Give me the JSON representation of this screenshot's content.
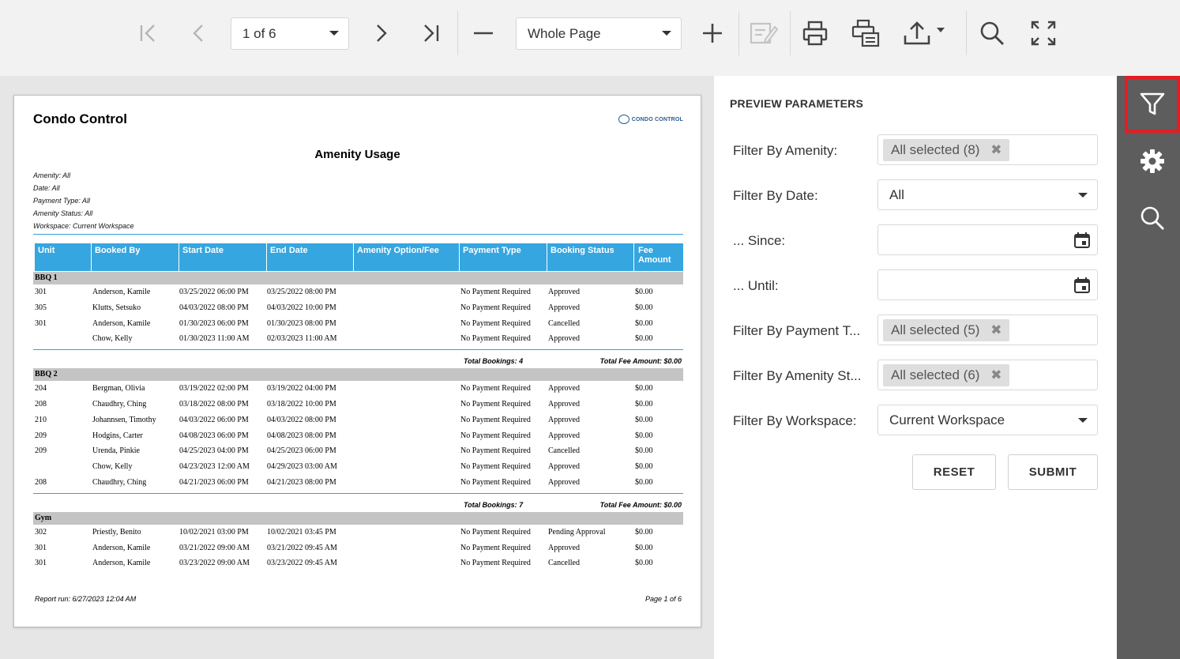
{
  "toolbar": {
    "page_selector": "1 of 6",
    "zoom_selector": "Whole Page",
    "icons": [
      "first-page-icon",
      "prev-page-icon",
      "next-page-icon",
      "last-page-icon",
      "zoom-out-icon",
      "zoom-in-icon",
      "edit-icon",
      "print-icon",
      "print-page-icon",
      "export-icon",
      "search-icon",
      "fullscreen-icon"
    ]
  },
  "report": {
    "company": "Condo Control",
    "logo_text": "CONDO CONTROL",
    "title": "Amenity Usage",
    "filters": [
      "Amenity: All",
      "Date: All",
      "Payment Type: All",
      "Amenity Status: All",
      "Workspace: Current Workspace"
    ],
    "columns": [
      "Unit",
      "Booked By",
      "Start Date",
      "End Date",
      "Amenity Option/Fee",
      "Payment Type",
      "Booking Status",
      "Fee Amount"
    ],
    "groups": [
      {
        "name": "BBQ 1",
        "rows": [
          [
            "301",
            "Anderson, Kamile",
            "03/25/2022 06:00 PM",
            "03/25/2022 08:00 PM",
            "",
            "No Payment Required",
            "Approved",
            "$0.00"
          ],
          [
            "305",
            "Klutts, Setsuko",
            "04/03/2022 08:00 PM",
            "04/03/2022 10:00 PM",
            "",
            "No Payment Required",
            "Approved",
            "$0.00"
          ],
          [
            "301",
            "Anderson, Kamile",
            "01/30/2023 06:00 PM",
            "01/30/2023 08:00 PM",
            "",
            "No Payment Required",
            "Cancelled",
            "$0.00"
          ],
          [
            "",
            "Chow, Kelly",
            "01/30/2023 11:00 AM",
            "02/03/2023 11:00 AM",
            "",
            "No Payment Required",
            "Approved",
            "$0.00"
          ]
        ],
        "total_bookings": "Total Bookings: 4",
        "total_fee": "Total Fee Amount: $0.00"
      },
      {
        "name": "BBQ 2",
        "rows": [
          [
            "204",
            "Bergman, Olivia",
            "03/19/2022 02:00 PM",
            "03/19/2022 04:00 PM",
            "",
            "No Payment Required",
            "Approved",
            "$0.00"
          ],
          [
            "208",
            "Chaudhry, Ching",
            "03/18/2022 08:00 PM",
            "03/18/2022 10:00 PM",
            "",
            "No Payment Required",
            "Approved",
            "$0.00"
          ],
          [
            "210",
            "Johannsen, Timothy",
            "04/03/2022 06:00 PM",
            "04/03/2022 08:00 PM",
            "",
            "No Payment Required",
            "Approved",
            "$0.00"
          ],
          [
            "209",
            "Hodgins, Carter",
            "04/08/2023 06:00 PM",
            "04/08/2023 08:00 PM",
            "",
            "No Payment Required",
            "Approved",
            "$0.00"
          ],
          [
            "209",
            "Urenda, Pinkie",
            "04/25/2023 04:00 PM",
            "04/25/2023 06:00 PM",
            "",
            "No Payment Required",
            "Cancelled",
            "$0.00"
          ],
          [
            "",
            "Chow, Kelly",
            "04/23/2023 12:00 AM",
            "04/29/2023 03:00 AM",
            "",
            "No Payment Required",
            "Approved",
            "$0.00"
          ],
          [
            "208",
            "Chaudhry, Ching",
            "04/21/2023 06:00 PM",
            "04/21/2023 08:00 PM",
            "",
            "No Payment Required",
            "Approved",
            "$0.00"
          ]
        ],
        "total_bookings": "Total Bookings: 7",
        "total_fee": "Total Fee Amount: $0.00"
      },
      {
        "name": "Gym",
        "rows": [
          [
            "302",
            "Priestly, Benito",
            "10/02/2021 03:00 PM",
            "10/02/2021 03:45 PM",
            "",
            "No Payment Required",
            "Pending Approval",
            "$0.00"
          ],
          [
            "301",
            "Anderson, Kamile",
            "03/21/2022 09:00 AM",
            "03/21/2022 09:45 AM",
            "",
            "No Payment Required",
            "Approved",
            "$0.00"
          ],
          [
            "301",
            "Anderson, Kamile",
            "03/23/2022 09:00 AM",
            "03/23/2022 09:45 AM",
            "",
            "No Payment Required",
            "Cancelled",
            "$0.00"
          ]
        ]
      }
    ],
    "footer_left": "Report run: 6/27/2023 12:04 AM",
    "footer_right": "Page 1 of 6"
  },
  "params": {
    "title": "PREVIEW PARAMETERS",
    "amenity": {
      "label": "Filter By Amenity:",
      "value": "All selected (8)"
    },
    "date": {
      "label": "Filter By Date:",
      "value": "All"
    },
    "since": {
      "label": "... Since:",
      "value": ""
    },
    "until": {
      "label": "... Until:",
      "value": ""
    },
    "payment": {
      "label": "Filter By Payment T...",
      "value": "All selected (5)"
    },
    "status": {
      "label": "Filter By Amenity St...",
      "value": "All selected (6)"
    },
    "workspace": {
      "label": "Filter By Workspace:",
      "value": "Current Workspace"
    },
    "reset": "RESET",
    "submit": "SUBMIT"
  },
  "sidebar": {
    "items": [
      "filter-icon",
      "settings-icon",
      "search-icon"
    ],
    "active": "filter-icon",
    "active_color": "#e51c23"
  }
}
